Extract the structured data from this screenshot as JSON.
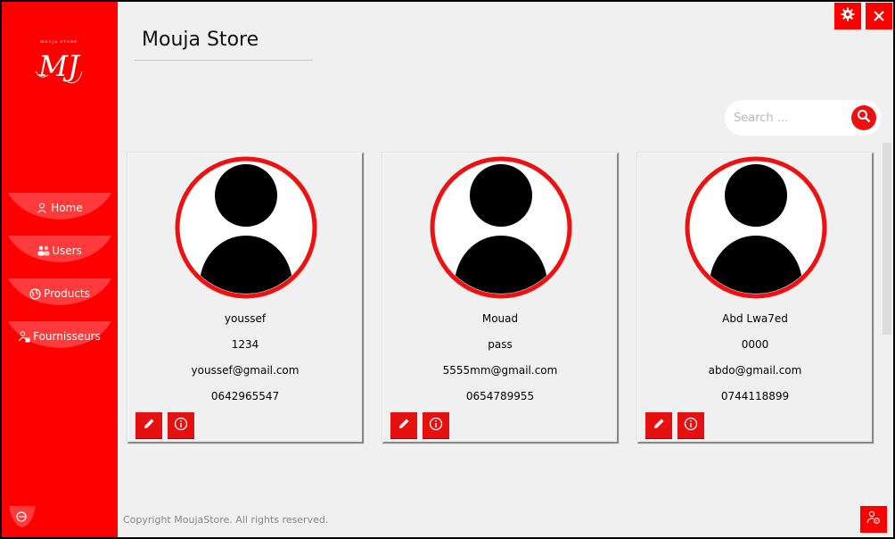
{
  "app": {
    "title": "Mouja Store",
    "logo_text": "MJ",
    "logo_subtext": "MOUJA STORE"
  },
  "sidebar": {
    "items": [
      {
        "label": "Home",
        "icon": "user-icon"
      },
      {
        "label": "Users",
        "icon": "users-icon"
      },
      {
        "label": "Products",
        "icon": "globe-icon"
      },
      {
        "label": "Fournisseurs",
        "icon": "supplier-icon"
      }
    ],
    "logout_icon": "logout-icon"
  },
  "window_controls": {
    "settings_icon": "gear-icon",
    "close_icon": "close-icon"
  },
  "search": {
    "placeholder": "Search ...",
    "icon": "search-icon"
  },
  "users": [
    {
      "name": "youssef",
      "password": "1234",
      "email": "youssef@gmail.com",
      "phone": "0642965547"
    },
    {
      "name": "Mouad",
      "password": "pass",
      "email": "5555mm@gmail.com",
      "phone": "0654789955"
    },
    {
      "name": "Abd Lwa7ed",
      "password": "0000",
      "email": "abdo@gmail.com",
      "phone": "0744118899"
    }
  ],
  "footer": {
    "copyright": "Copyright MoujaStore. All rights reserved."
  },
  "colors": {
    "accent": "#ff0000",
    "background": "#f0f0f0"
  }
}
